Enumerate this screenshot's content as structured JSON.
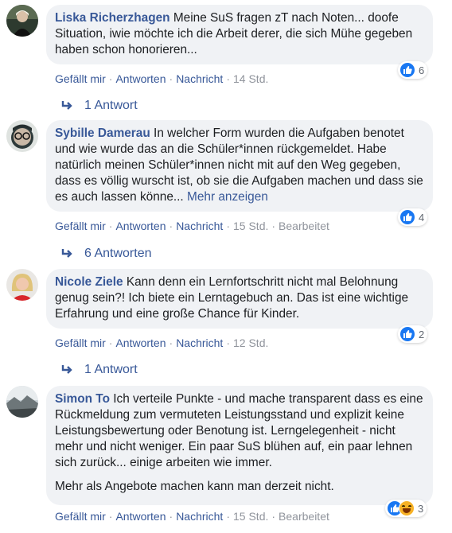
{
  "comments": [
    {
      "author": "Liska Richerzhagen",
      "text": "Meine SuS fragen zT nach Noten... doofe Situation, iwie möchte ich die Arbeit derer, die sich Mühe gegeben haben schon honorieren...",
      "actions": {
        "like": "Gefällt mir",
        "reply": "Antworten",
        "message": "Nachricht",
        "time": "14 Std."
      },
      "reaction_count": "6",
      "replies": "1 Antwort"
    },
    {
      "author": "Sybille Damerau",
      "text": "In welcher Form wurden die Aufgaben benotet und wie wurde das an die Schüler*innen rückgemeldet. Habe natürlich meinen Schüler*innen nicht mit auf den Weg gegeben, dass es völlig wurscht ist, ob sie die Aufgaben machen und dass sie es auch lassen könne...",
      "more": "Mehr anzeigen",
      "actions": {
        "like": "Gefällt mir",
        "reply": "Antworten",
        "message": "Nachricht",
        "time": "15 Std.",
        "edited": "Bearbeitet"
      },
      "reaction_count": "4",
      "replies": "6 Antworten"
    },
    {
      "author": "Nicole Ziele",
      "text": "Kann denn ein Lernfortschritt nicht mal Belohnung genug sein?! Ich biete ein Lerntagebuch an. Das ist eine wichtige Erfahrung und eine große Chance für Kinder.",
      "actions": {
        "like": "Gefällt mir",
        "reply": "Antworten",
        "message": "Nachricht",
        "time": "12 Std."
      },
      "reaction_count": "2",
      "replies": "1 Antwort"
    },
    {
      "author": "Simon To",
      "text": "Ich verteile Punkte - und mache transparent dass es eine Rückmeldung zum vermuteten Leistungsstand und explizit keine Leistungsbewertung oder Benotung ist. Lerngelegenheit - nicht mehr und nicht weniger. Ein paar SuS blühen auf, ein paar lehnen sich zurück... einige arbeiten wie immer.",
      "text2": "Mehr als Angebote machen kann man derzeit nicht.",
      "actions": {
        "like": "Gefällt mir",
        "reply": "Antworten",
        "message": "Nachricht",
        "time": "15 Std.",
        "edited": "Bearbeitet"
      },
      "reaction_count": "3"
    }
  ],
  "icons": {
    "like": "like-reaction-icon",
    "haha": "haha-reaction-icon",
    "reply_arrow": "reply-arrow-icon"
  },
  "colors": {
    "link": "#385898",
    "bubble": "#f0f2f5",
    "like_blue": "#1877f2"
  }
}
